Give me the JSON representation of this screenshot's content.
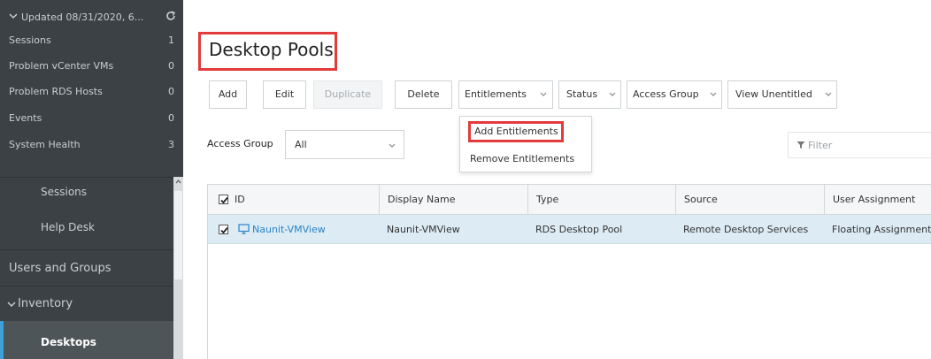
{
  "sidebar": {
    "status_header": "Updated 08/31/2020, 6...",
    "status_rows": [
      {
        "label": "Sessions",
        "count": "1"
      },
      {
        "label": "Problem vCenter VMs",
        "count": "0"
      },
      {
        "label": "Problem RDS Hosts",
        "count": "0"
      },
      {
        "label": "Events",
        "count": "0"
      },
      {
        "label": "System Health",
        "count": "3"
      }
    ],
    "nav": {
      "sessions": "Sessions",
      "help_desk": "Help Desk",
      "users_groups": "Users and Groups",
      "inventory": "Inventory",
      "desktops": "Desktops"
    }
  },
  "main": {
    "title": "Desktop Pools",
    "toolbar": {
      "add": "Add",
      "edit": "Edit",
      "duplicate": "Duplicate",
      "delete": "Delete",
      "entitlements": "Entitlements",
      "status": "Status",
      "access_group": "Access Group",
      "view_unentitled": "View Unentitled"
    },
    "entitlements_menu": {
      "add": "Add Entitlements",
      "remove": "Remove Entitlements"
    },
    "access_group_filter": {
      "label": "Access Group",
      "value": "All"
    },
    "filter_placeholder": "Filter",
    "table": {
      "columns": [
        "ID",
        "Display Name",
        "Type",
        "Source",
        "User Assignment"
      ],
      "rows": [
        {
          "id": "Naunit-VMView",
          "display_name": "Naunit-VMView",
          "type": "RDS Desktop Pool",
          "source": "Remote Desktop Services",
          "user_assignment": "Floating Assignment"
        }
      ]
    }
  },
  "colors": {
    "sidebar_bg": "#3b4145",
    "highlight_red": "#e23b3b",
    "link_blue": "#2c83c5",
    "selected_row": "#dcebf4",
    "active_nav_bar": "#3f9fd8"
  }
}
